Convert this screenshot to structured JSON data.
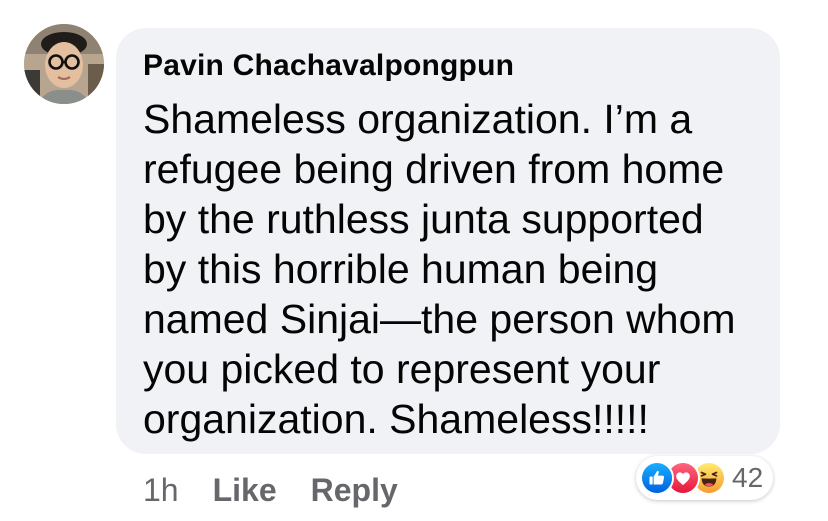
{
  "comment": {
    "author": "Pavin Chachavalpongpun",
    "text_lines": [
      "Shameless organization. I’m a",
      "refugee being driven from home",
      "by the ruthless junta supported",
      "by this horrible human being",
      "named Sinjai—the person whom",
      "you picked to represent your",
      "organization. Shameless!!!!!"
    ],
    "time": "1h",
    "like_label": "Like",
    "reply_label": "Reply"
  },
  "reactions": {
    "icons": [
      "like-icon",
      "love-icon",
      "haha-icon"
    ],
    "count": "42"
  },
  "colors": {
    "bubble_bg": "#f0f2f5",
    "text": "#050505",
    "meta_text": "#65676b",
    "like_blue": "#1877f2",
    "love_red": "#f33e58",
    "haha_yellow": "#f7b928"
  }
}
